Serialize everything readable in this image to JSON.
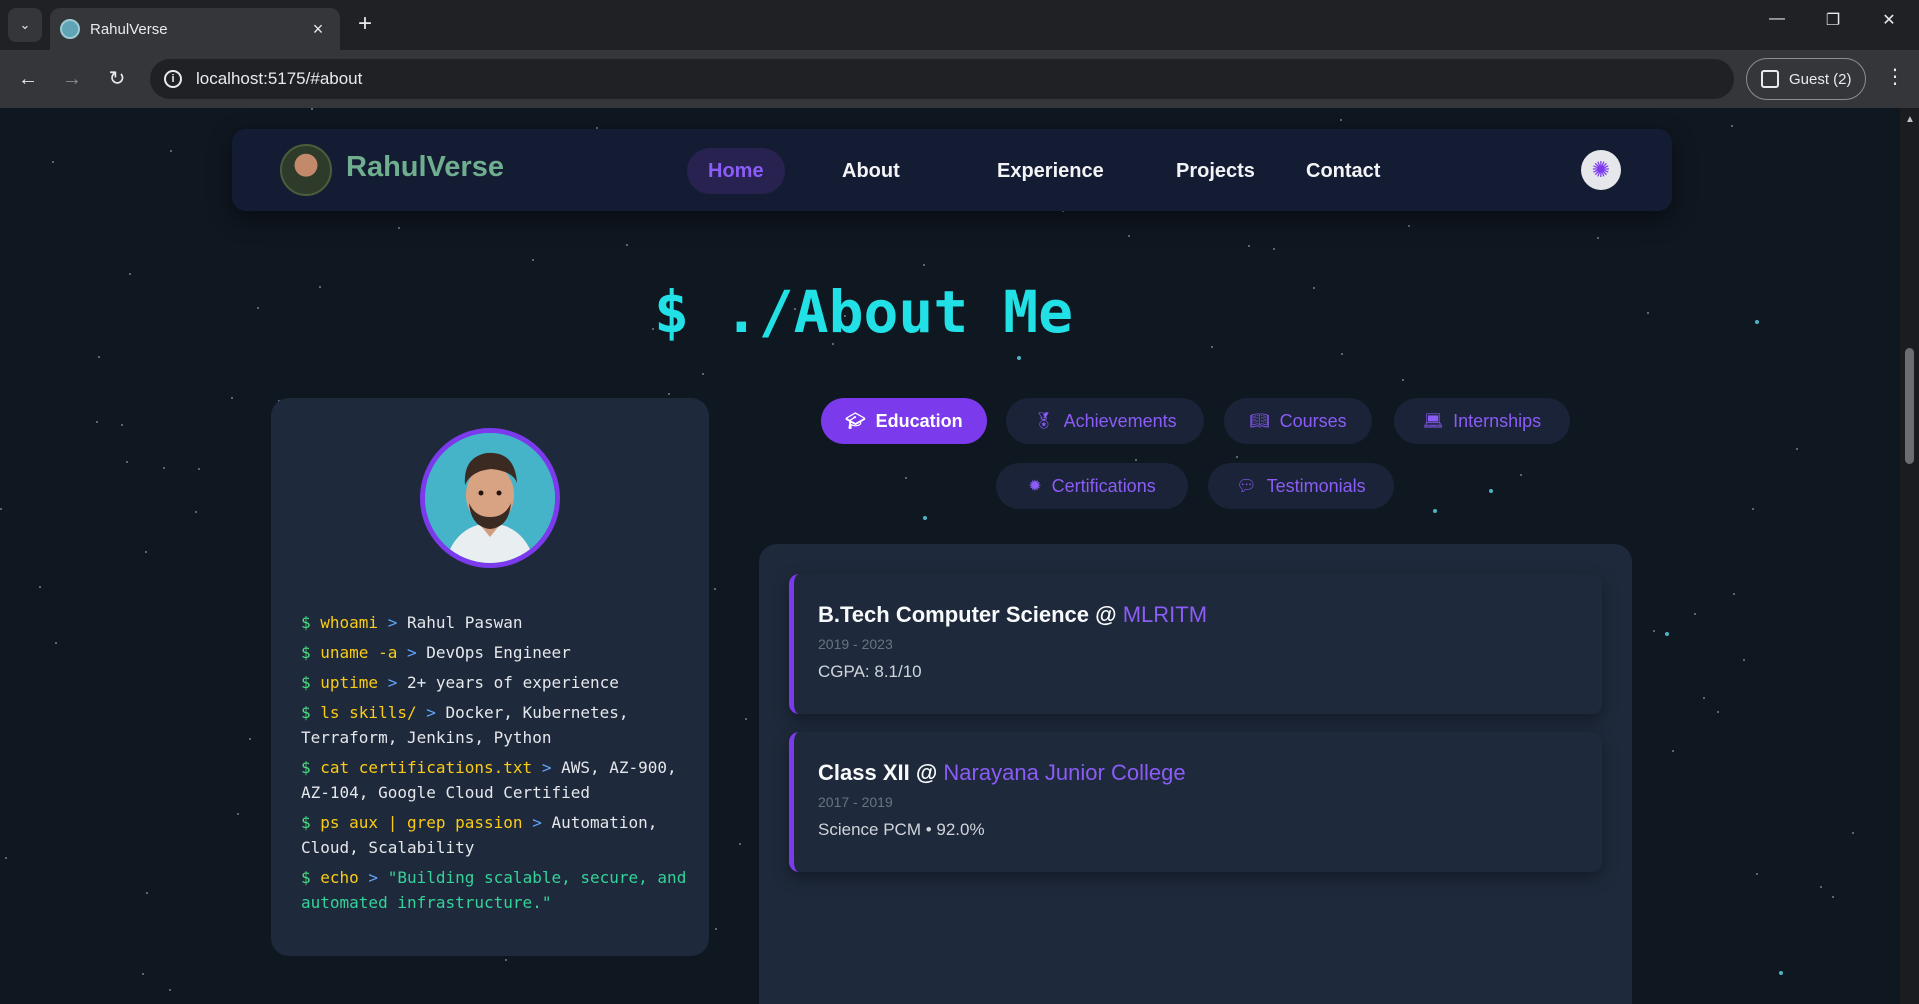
{
  "browser": {
    "tab_title": "RahulVerse",
    "url": "localhost:5175/#about",
    "profile_label": "Guest (2)"
  },
  "nav": {
    "brand": "RahulVerse",
    "links": [
      "Home",
      "About",
      "Experience",
      "Projects",
      "Contact"
    ],
    "active": "Home"
  },
  "section_title": "$ ./About Me",
  "terminal": [
    {
      "cmd": "whoami",
      "out": "Rahul Paswan"
    },
    {
      "cmd": "uname -a",
      "out": "DevOps Engineer"
    },
    {
      "cmd": "uptime",
      "out": "2+ years of experience"
    },
    {
      "cmd": "ls skills/",
      "out": "Docker, Kubernetes, Terraform, Jenkins, Python"
    },
    {
      "cmd": "cat certifications.txt",
      "out": "AWS, AZ-900, AZ-104, Google Cloud Certified"
    },
    {
      "cmd": "ps aux | grep passion",
      "out": "Automation, Cloud, Scalability"
    },
    {
      "cmd": "echo",
      "out": "\"Building scalable, secure, and automated infrastructure.\""
    }
  ],
  "tabs": [
    "Education",
    "Achievements",
    "Courses",
    "Internships",
    "Certifications",
    "Testimonials"
  ],
  "active_tab": "Education",
  "education": [
    {
      "degree": "B.Tech Computer Science",
      "at": "@",
      "institution": "MLRITM",
      "years": "2019 - 2023",
      "detail": "CGPA: 8.1/10"
    },
    {
      "degree": "Class XII",
      "at": "@",
      "institution": "Narayana Junior College",
      "years": "2017 - 2019",
      "detail": "Science PCM • 92.0%"
    }
  ],
  "icons": {
    "education": "graduation-icon",
    "achievements": "medal-icon",
    "courses": "book-icon",
    "internships": "laptop-icon",
    "certifications": "badge-icon",
    "testimonials": "chat-icon",
    "theme": "sun-icon"
  },
  "colors": {
    "accent": "#7c3aed",
    "title": "#22e1e6",
    "brand": "#6fae8e",
    "background": "#0f1720",
    "card": "#1e293b"
  }
}
